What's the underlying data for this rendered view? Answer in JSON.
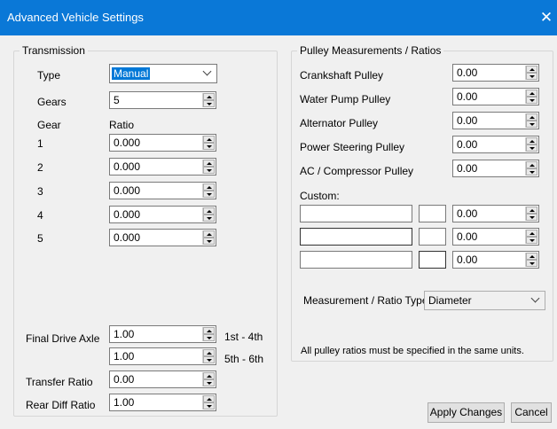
{
  "window": {
    "title": "Advanced Vehicle Settings",
    "close_glyph": "✕"
  },
  "transmission": {
    "legend": "Transmission",
    "type_label": "Type",
    "type_value": "Manual",
    "gears_label": "Gears",
    "gears_value": "5",
    "gear_header": "Gear",
    "ratio_header": "Ratio",
    "gears": [
      {
        "label": "1",
        "ratio": "0.000"
      },
      {
        "label": "2",
        "ratio": "0.000"
      },
      {
        "label": "3",
        "ratio": "0.000"
      },
      {
        "label": "4",
        "ratio": "0.000"
      },
      {
        "label": "5",
        "ratio": "0.000"
      }
    ],
    "final_drive_label": "Final Drive Axle",
    "final_drive_1": "1.00",
    "final_drive_1_note": "1st - 4th",
    "final_drive_2": "1.00",
    "final_drive_2_note": "5th - 6th",
    "transfer_label": "Transfer Ratio",
    "transfer_value": "0.00",
    "rear_diff_label": "Rear Diff Ratio",
    "rear_diff_value": "1.00"
  },
  "pulleys": {
    "legend": "Pulley Measurements / Ratios",
    "items": [
      {
        "label": "Crankshaft Pulley",
        "value": "0.00"
      },
      {
        "label": "Water Pump Pulley",
        "value": "0.00"
      },
      {
        "label": "Alternator Pulley",
        "value": "0.00"
      },
      {
        "label": "Power Steering Pulley",
        "value": "0.00"
      },
      {
        "label": "AC / Compressor Pulley",
        "value": "0.00"
      }
    ],
    "custom_label": "Custom:",
    "custom": [
      {
        "name": "",
        "code": "",
        "value": "0.00"
      },
      {
        "name": "",
        "code": "",
        "value": "0.00"
      },
      {
        "name": "",
        "code": "",
        "value": "0.00"
      }
    ],
    "measurement_label": "Measurement / Ratio Type",
    "measurement_value": "Diameter",
    "note": "All pulley ratios must be specified in the same units."
  },
  "buttons": {
    "apply": "Apply Changes",
    "cancel": "Cancel"
  },
  "colors": {
    "title_bar": "#0a78d7",
    "dialog_bg": "#f0f0f0",
    "selection": "#0078d7"
  },
  "icons": {
    "spin_up": "triangle-up",
    "spin_down": "triangle-down",
    "dropdown": "chevron-down",
    "close": "x"
  }
}
